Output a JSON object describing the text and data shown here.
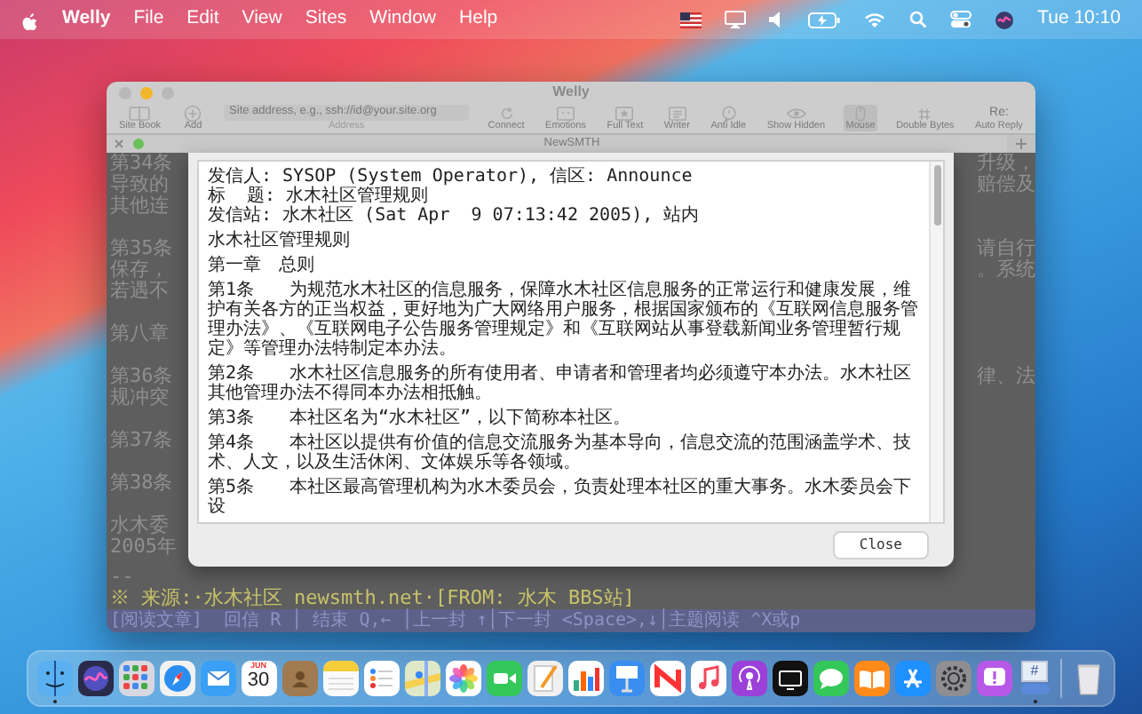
{
  "menubar": {
    "app_name": "Welly",
    "menus": [
      "File",
      "Edit",
      "View",
      "Sites",
      "Window",
      "Help"
    ],
    "clock": "Tue 10:10"
  },
  "window": {
    "title": "Welly",
    "toolbar": [
      {
        "kind": "sitebook",
        "label": "Site Book",
        "on": false
      },
      {
        "kind": "add",
        "label": "Add",
        "on": false
      },
      {
        "kind": "address",
        "label": "Address",
        "placeholder": "Site address, e.g., ssh://id@your.site.org"
      },
      {
        "kind": "connect",
        "label": "Connect",
        "on": false
      },
      {
        "kind": "emotions",
        "label": "Emotions",
        "on": false
      },
      {
        "kind": "fulltext",
        "label": "Full Text",
        "on": false
      },
      {
        "kind": "writer",
        "label": "Writer",
        "on": false
      },
      {
        "kind": "antiidle",
        "label": "Anti Idle",
        "on": false
      },
      {
        "kind": "showhidden",
        "label": "Show Hidden",
        "on": false
      },
      {
        "kind": "mouse",
        "label": "Mouse",
        "on": true
      },
      {
        "kind": "doublebytes",
        "label": "Double Bytes",
        "on": false
      },
      {
        "kind": "autoreply",
        "label": "Auto Reply",
        "icon_text": "Re:",
        "on": false
      }
    ],
    "tabs": [
      {
        "label": "NewSMTH",
        "selected": true,
        "connected": true
      }
    ],
    "terminal": {
      "rows": [
        {
          "kind": "text",
          "left": "第34条",
          "right": "升级，"
        },
        {
          "kind": "text",
          "left": "导致的",
          "right": "赔偿及"
        },
        {
          "kind": "text",
          "left": "其他连"
        },
        {
          "kind": "blank"
        },
        {
          "kind": "text",
          "left": "第35条",
          "right": "请自行"
        },
        {
          "kind": "text",
          "left": "保存，",
          "right": "。系统"
        },
        {
          "kind": "text",
          "left": "若遇不"
        },
        {
          "kind": "blank"
        },
        {
          "kind": "text",
          "left": "第八章"
        },
        {
          "kind": "blank"
        },
        {
          "kind": "text",
          "left": "第36条",
          "right": "律、法"
        },
        {
          "kind": "text",
          "left": "规冲突"
        },
        {
          "kind": "blank"
        },
        {
          "kind": "text",
          "left": "第37条"
        },
        {
          "kind": "blank"
        },
        {
          "kind": "text",
          "left": "第38条"
        },
        {
          "kind": "blank"
        },
        {
          "kind": "text",
          "left": "水木委"
        },
        {
          "kind": "text",
          "left": "2005年"
        }
      ],
      "lines_below": [
        {
          "kind": "plain",
          "text": "--"
        },
        {
          "kind": "source",
          "text": "※ 来源:·水木社区 newsmth.net·[FROM: 水木 BBS站]"
        }
      ],
      "status_bar": "[阅读文章]  回信 R │ 结束 Q,← │上一封 ↑│下一封 <Space>,↓│主题阅读 ^X或p"
    },
    "sheet": {
      "lines": [
        {
          "kind": "header",
          "text": "发信人: SYSOP (System Operator), 信区: Announce"
        },
        {
          "kind": "header",
          "text": "标  题: 水木社区管理规则"
        },
        {
          "kind": "header",
          "text": "发信站: 水木社区 (Sat Apr  9 07:13:42 2005), 站内"
        },
        {
          "kind": "para",
          "text": "水木社区管理规则"
        },
        {
          "kind": "para",
          "text": "第一章　总则"
        },
        {
          "kind": "para",
          "text": "第1条　　为规范水木社区的信息服务，保障水木社区信息服务的正常运行和健康发展，维护有关各方的正当权益，更好地为广大网络用户服务，根据国家颁布的《互联网信息服务管理办法》、《互联网电子公告服务管理规定》和《互联网站从事登载新闻业务管理暂行规定》等管理办法特制定本办法。"
        },
        {
          "kind": "para",
          "text": "第2条　　水木社区信息服务的所有使用者、申请者和管理者均必须遵守本办法。水木社区其他管理办法不得同本办法相抵触。"
        },
        {
          "kind": "para",
          "text": "第3条　　本社区名为“水木社区”，以下简称本社区。"
        },
        {
          "kind": "para",
          "text": "第4条　　本社区以提供有价值的信息交流服务为基本导向，信息交流的范围涵盖学术、技术、人文，以及生活休闲、文体娱乐等各领域。"
        },
        {
          "kind": "para",
          "text": "第5条　　本社区最高管理机构为水木委员会，负责处理本社区的重大事务。水木委员会下设"
        }
      ],
      "button": "Close"
    }
  },
  "dock": {
    "items": [
      {
        "kind": "finder",
        "running": true
      },
      {
        "kind": "siri",
        "running": false
      },
      {
        "kind": "launchpad",
        "running": false
      },
      {
        "kind": "safari",
        "running": false
      },
      {
        "kind": "mail",
        "running": false
      },
      {
        "kind": "calendar",
        "running": false,
        "month": "JUN",
        "day": "30"
      },
      {
        "kind": "contacts",
        "running": false
      },
      {
        "kind": "notes",
        "running": false
      },
      {
        "kind": "reminders",
        "running": false
      },
      {
        "kind": "maps",
        "running": false
      },
      {
        "kind": "photos",
        "running": false
      },
      {
        "kind": "facetime",
        "running": false
      },
      {
        "kind": "pages",
        "running": false
      },
      {
        "kind": "numbers",
        "running": false
      },
      {
        "kind": "keynote",
        "running": false
      },
      {
        "kind": "news",
        "running": false
      },
      {
        "kind": "music",
        "running": false
      },
      {
        "kind": "podcasts",
        "running": false
      },
      {
        "kind": "tv",
        "running": false
      },
      {
        "kind": "messages",
        "running": false
      },
      {
        "kind": "books",
        "running": false
      },
      {
        "kind": "appstore",
        "running": false
      },
      {
        "kind": "settings",
        "running": false
      },
      {
        "kind": "feedback",
        "running": false
      },
      {
        "kind": "welly",
        "running": true,
        "icon_text": "#"
      },
      {
        "kind": "trash",
        "running": false
      }
    ]
  }
}
